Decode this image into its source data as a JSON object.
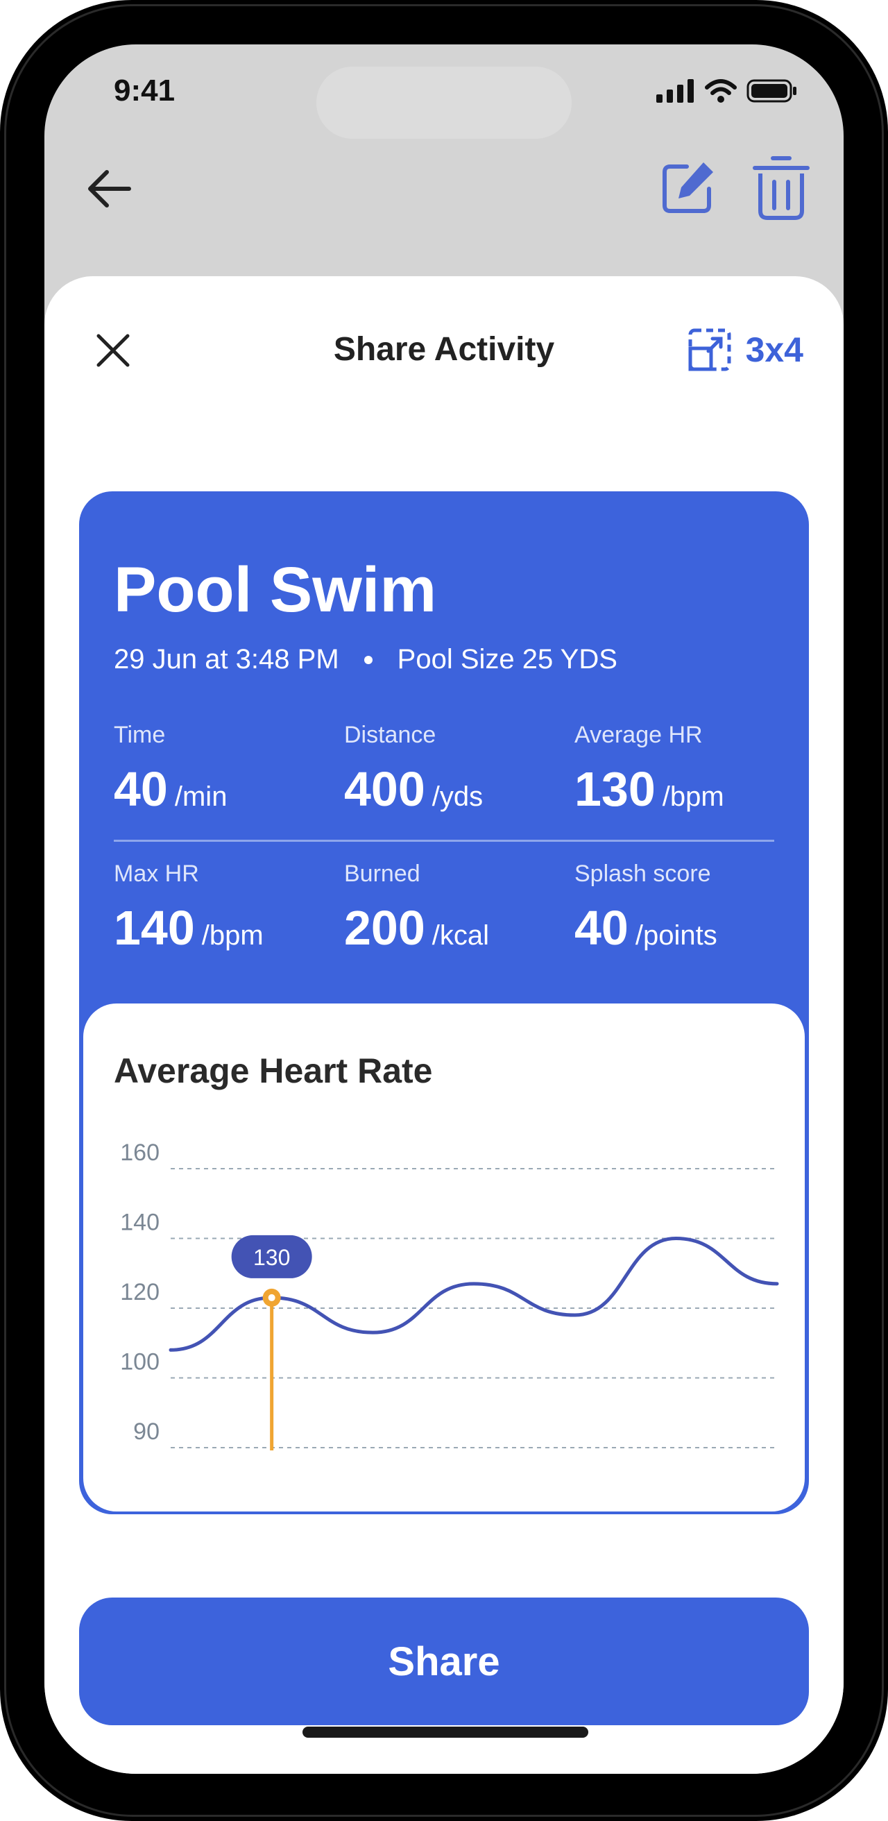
{
  "status_bar": {
    "time": "9:41"
  },
  "colors": {
    "accent": "#3d63dc",
    "chart_line": "#4353b4",
    "marker": "#f0a532",
    "tooltip": "#4353b4"
  },
  "icons": {
    "back": "arrow-left-icon",
    "edit": "edit-icon",
    "delete": "trash-icon",
    "close": "close-icon",
    "aspect_ratio": "aspect-ratio-icon"
  },
  "sheet": {
    "title": "Share Activity",
    "ratio_label": "3x4"
  },
  "activity": {
    "title": "Pool Swim",
    "date": "29 Jun at 3:48 PM",
    "pool_size": "Pool Size 25 YDS",
    "stats": [
      {
        "label": "Time",
        "value": "40",
        "unit": "/min"
      },
      {
        "label": "Distance",
        "value": "400",
        "unit": "/yds"
      },
      {
        "label": "Average HR",
        "value": "130",
        "unit": "/bpm"
      },
      {
        "label": "Max HR",
        "value": "140",
        "unit": "/bpm"
      },
      {
        "label": "Burned",
        "value": "200",
        "unit": "/kcal"
      },
      {
        "label": "Splash score",
        "value": "40",
        "unit": "/points"
      }
    ]
  },
  "chart_data": {
    "type": "line",
    "title": "Average Heart Rate",
    "y_ticks": [
      "160",
      "140",
      "120",
      "100",
      "90"
    ],
    "ylim": [
      90,
      160
    ],
    "grid": true,
    "series": [
      {
        "values": [
          108,
          123,
          113,
          127,
          118,
          140,
          127
        ]
      }
    ],
    "highlight": {
      "index": 1,
      "label": "130"
    }
  },
  "actions": {
    "share_label": "Share"
  }
}
